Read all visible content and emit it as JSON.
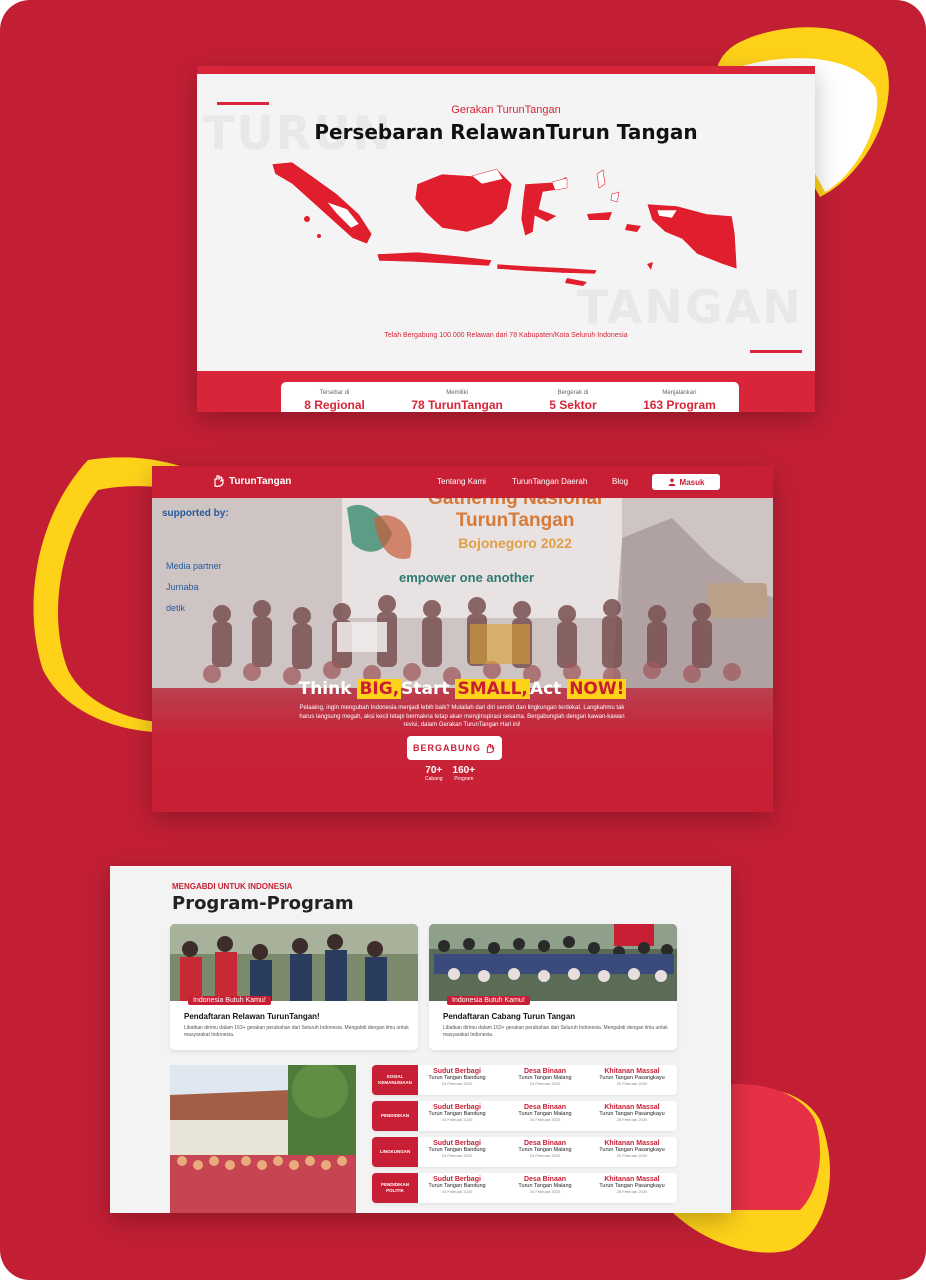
{
  "colors": {
    "brand_red": "#c81f35",
    "accent_yellow": "#ffd21a",
    "map_red": "#e01e2e"
  },
  "map_section": {
    "eyebrow": "Gerakan TurunTangan",
    "title": "Persebaran RelawanTurun Tangan",
    "caption": "Telah Bergabung 100.000 Relawan dari 78 Kabupaten/Kota Seluruh Indonesia",
    "stats": [
      {
        "label": "Tersebar di",
        "value": "8 Regional"
      },
      {
        "label": "Memiliki",
        "value": "78 TurunTangan"
      },
      {
        "label": "Bergerak di",
        "value": "5 Sektor"
      },
      {
        "label": "Menjalankan",
        "value": "163 Program"
      }
    ]
  },
  "nav": {
    "brand": "TurunTangan",
    "links": [
      "Tentang Kami",
      "TurunTangan Daerah",
      "Blog"
    ],
    "login": "Masuk"
  },
  "hero": {
    "supported_by": "supported by:",
    "media_partner": "Media partner",
    "media_items": [
      "Jurnaba",
      "detik"
    ],
    "banner_line1": "Gathering Nasional",
    "banner_line2": "TurunTangan",
    "banner_line3": "Bojonegoro 2022",
    "empower": "empower one another",
    "headline": [
      "Think",
      "BIG,",
      "Start",
      "SMALL,",
      "Act",
      "NOW!"
    ],
    "description": "Pelaaing, ingin mengubah Indonesia menjadi lebih baik? Mulailah dari diri sendiri dan lingkungan terdekat. Langkahmu tak harus langsung megah, aksi kecil tetapi bermakna tetap akan menginspirasi sesama. Bergabunglah dengan kawan-kawan revisi, dalam Gerakan TurunTangan Hari ini!",
    "cta": "BERGABUNG",
    "counts": [
      {
        "value": "70+",
        "label": "Cabang"
      },
      {
        "value": "160+",
        "label": "Program"
      }
    ]
  },
  "programs": {
    "eyebrow": "MENGABDI UNTUK INDONESIA",
    "title": "Program-Program",
    "cards": [
      {
        "badge": "Indonesia Butuh Kamu!",
        "title": "Pendaftaran Relawan TurunTangan!",
        "desc": "Libatkan dirimu dalam 163+ gerakan perubahan dari Seluruh Indonesia. Mengabdi dengan ilmu untuk masyarakat Indonesia."
      },
      {
        "badge": "Indonesia Butuh Kamu!",
        "title": "Pendaftaran Cabang Turun Tangan",
        "desc": "Libatkan dirimu dalam 163+ gerakan perubahan dari Seluruh Indonesia. Mengabdi dengan ilmu untuk masyarakat Indonesia."
      }
    ],
    "school_caption": "",
    "rows": [
      {
        "category": "SOSIAL KEMANUSIAAN",
        "items": [
          {
            "name": "Sudut Berbagi",
            "location": "Turun Tangan Bandung",
            "date": "24 Februari 2020"
          },
          {
            "name": "Desa Binaan",
            "location": "Turun Tangan Malang",
            "date": "24 Februari 2020"
          },
          {
            "name": "Khitanan Massal",
            "location": "Turun Tangan Pasangkayu",
            "date": "25 Februari 2020"
          }
        ]
      },
      {
        "category": "PENDIDIKAN",
        "items": [
          {
            "name": "Sudut Berbagi",
            "location": "Turun Tangan Bandung",
            "date": "24 Februari 2020"
          },
          {
            "name": "Desa Binaan",
            "location": "Turun Tangan Malang",
            "date": "24 Februari 2020"
          },
          {
            "name": "Khitanan Massal",
            "location": "Turun Tangan Pasangkayu",
            "date": "25 Februari 2020"
          }
        ]
      },
      {
        "category": "LINGKUNGAN",
        "items": [
          {
            "name": "Sudut Berbagi",
            "location": "Turun Tangan Bandung",
            "date": "24 Februari 2020"
          },
          {
            "name": "Desa Binaan",
            "location": "Turun Tangan Malang",
            "date": "24 Februari 2020"
          },
          {
            "name": "Khitanan Massal",
            "location": "Turun Tangan Pasangkayu",
            "date": "25 Februari 2020"
          }
        ]
      },
      {
        "category": "PENDIDIKAN POLITIK",
        "items": [
          {
            "name": "Sudut Berbagi",
            "location": "Turun Tangan Bandung",
            "date": "24 Februari 2020"
          },
          {
            "name": "Desa Binaan",
            "location": "Turun Tangan Malang",
            "date": "24 Februari 2020"
          },
          {
            "name": "Khitanan Massal",
            "location": "Turun Tangan Pasangkayu",
            "date": "25 Februari 2020"
          }
        ]
      }
    ]
  }
}
